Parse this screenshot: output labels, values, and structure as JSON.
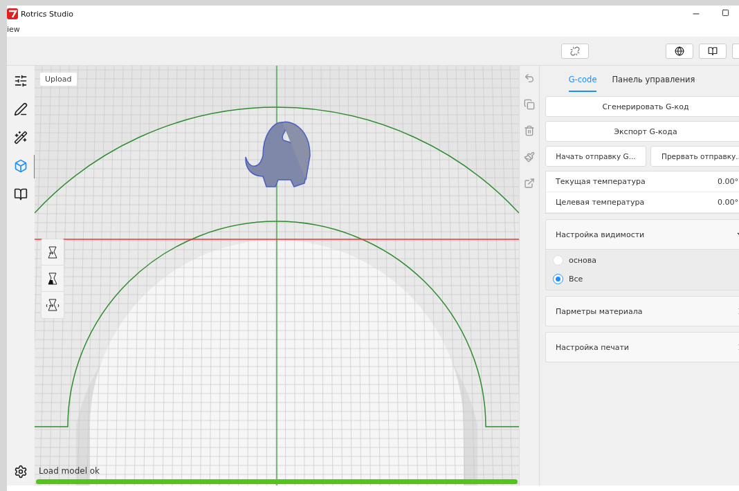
{
  "window": {
    "title": "Rotrics Studio"
  },
  "menu": [
    "iew"
  ],
  "viewport": {
    "upload_button": "Upload",
    "status": "Load model ok",
    "progress": {
      "level": 1
    }
  },
  "right_panel": {
    "tabs": [
      {
        "label": "G-code",
        "selected": true
      },
      {
        "label": "Панель управления",
        "selected": false
      }
    ],
    "generate_button": "Сгенерировать G-код",
    "export_button": "Экспорт G-кода",
    "send_buttons": [
      "Начать отправку G...",
      "Прервать отправку.."
    ],
    "temperatures": [
      {
        "label": "Текущая температура",
        "value": "0.00°"
      },
      {
        "label": "Целевая температура",
        "value": "0.00°"
      }
    ],
    "sections": [
      {
        "title": "Настройка видимости",
        "expanded": true,
        "options": [
          {
            "label": "основа",
            "selected": false
          },
          {
            "label": "Все",
            "selected": true
          }
        ]
      },
      {
        "title": "Парметры материала",
        "expanded": false
      },
      {
        "title": "Настройка печати",
        "expanded": false
      }
    ]
  }
}
